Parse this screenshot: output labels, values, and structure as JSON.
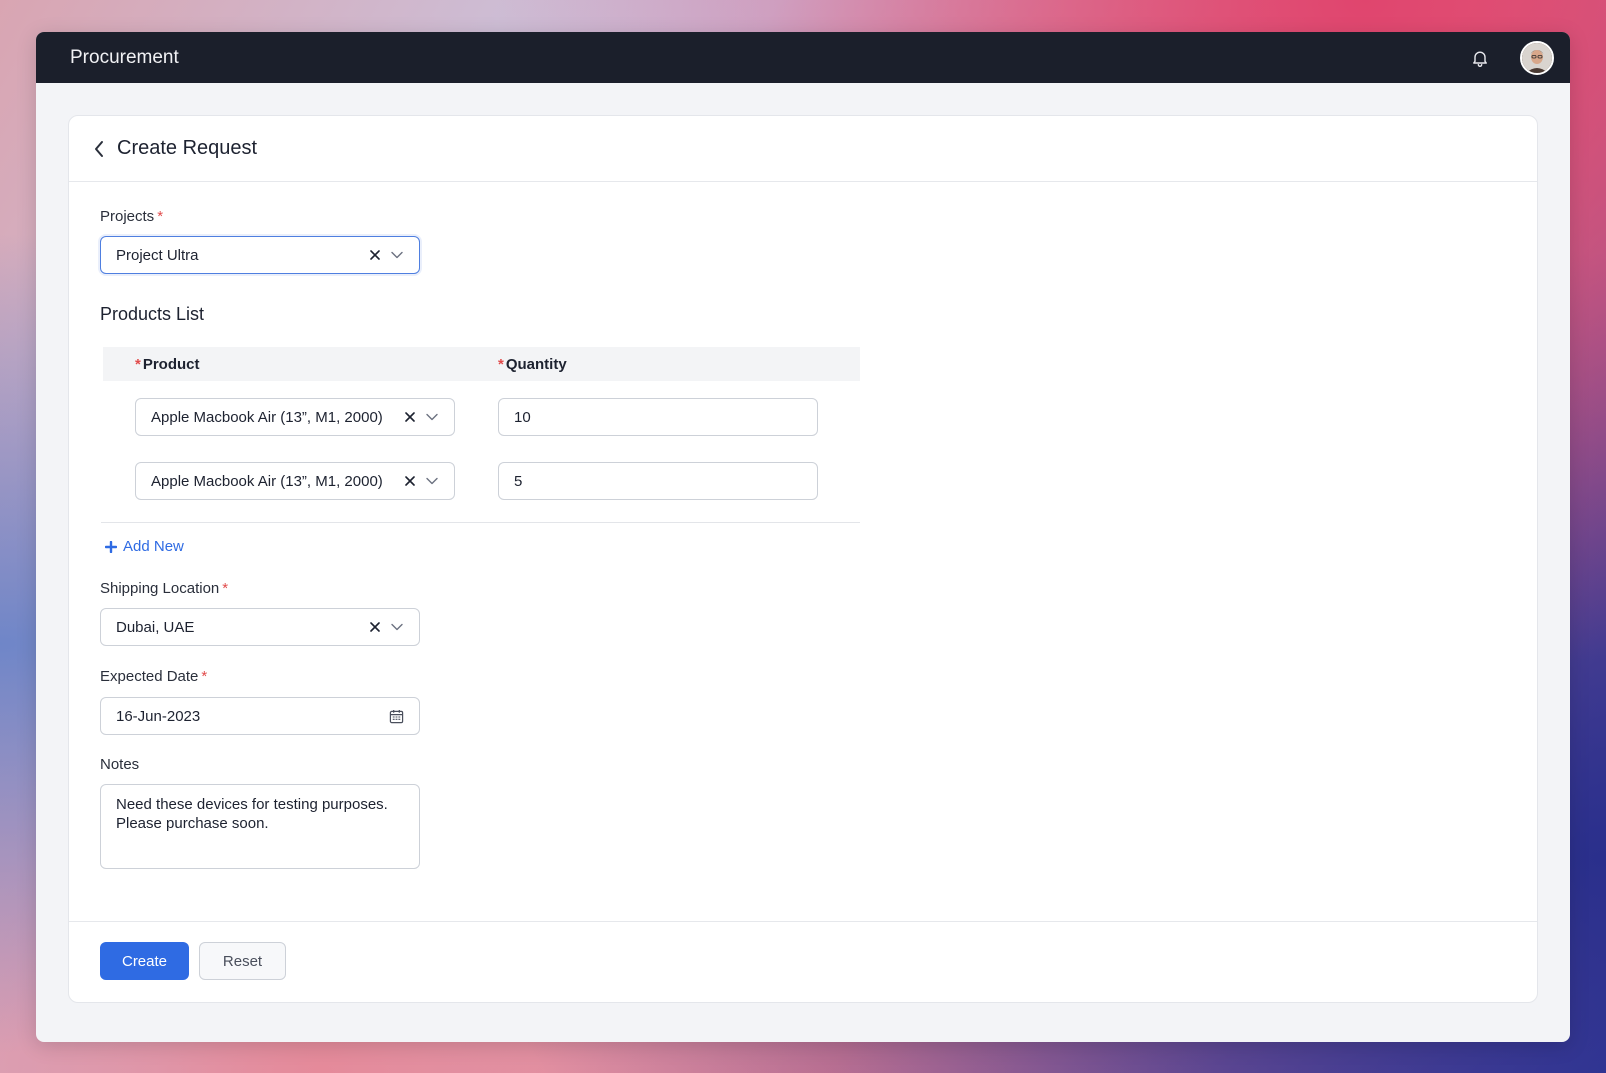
{
  "app": {
    "title": "Procurement"
  },
  "header": {
    "title": "Create Request"
  },
  "form": {
    "projects": {
      "label": "Projects",
      "value": "Project Ultra"
    },
    "products_list": {
      "title": "Products List",
      "columns": {
        "product": "Product",
        "quantity": "Quantity"
      },
      "rows": [
        {
          "product": "Apple Macbook Air (13”, M1, 2000)",
          "quantity": "10"
        },
        {
          "product": "Apple Macbook Air (13”, M1, 2000)",
          "quantity": "5"
        }
      ],
      "add_new_label": "Add New"
    },
    "shipping_location": {
      "label": "Shipping Location",
      "value": "Dubai, UAE"
    },
    "expected_date": {
      "label": "Expected Date",
      "value": "16-Jun-2023"
    },
    "notes": {
      "label": "Notes",
      "value": "Need these devices for testing purposes. Please purchase soon."
    }
  },
  "actions": {
    "create_label": "Create",
    "reset_label": "Reset"
  },
  "icons": {
    "bell": "bell-icon",
    "avatar": "user-avatar",
    "back": "chevron-left-icon",
    "clear": "close-icon",
    "dropdown": "chevron-down-icon",
    "calendar": "calendar-icon",
    "plus": "plus-icon"
  },
  "colors": {
    "accent": "#2f6be3",
    "required": "#e14b4b",
    "topbar": "#1b1f2b"
  }
}
